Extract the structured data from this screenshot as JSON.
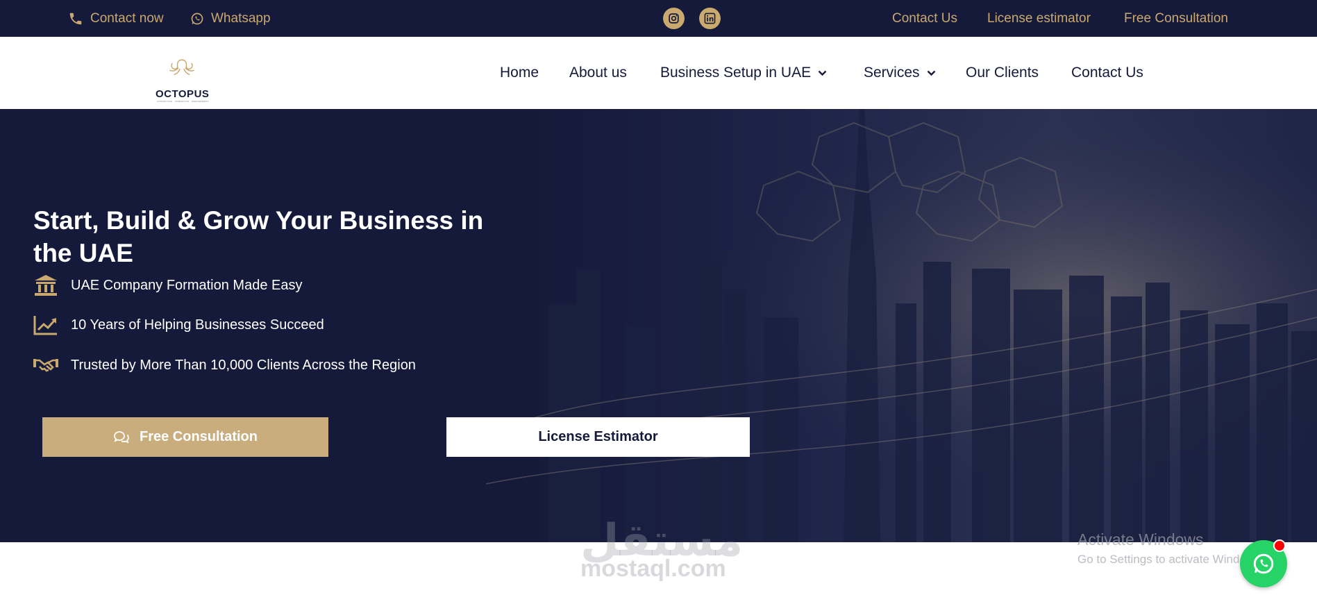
{
  "topbar": {
    "contact_now": "Contact now",
    "whatsapp": "Whatsapp",
    "links": [
      "Contact Us",
      "License estimator",
      "Free Consultation"
    ],
    "social_icons": [
      "instagram-icon",
      "linkedin-icon"
    ]
  },
  "header": {
    "logo_text": "OCTOPUS",
    "logo_sub": "CONSULTING · FORMATION · MANAGEMENT",
    "nav": [
      {
        "label": "Home"
      },
      {
        "label": "About us"
      },
      {
        "label": "Business Setup in UAE"
      },
      {
        "label": "Services"
      },
      {
        "label": "Our Clients"
      },
      {
        "label": "Contact Us"
      }
    ]
  },
  "hero": {
    "title": "Start, Build & Grow Your Business in the UAE",
    "features": [
      {
        "text": "UAE Company Formation Made Easy",
        "icon": "bank-icon"
      },
      {
        "text": "10 Years of Helping Businesses Succeed",
        "icon": "chart-growth-icon"
      },
      {
        "text": "Trusted by More Than 10,000 Clients Across the Region",
        "icon": "handshake-icon"
      }
    ],
    "btn_consult": "Free Consultation",
    "btn_estimator": "License Estimator"
  },
  "overlay": {
    "watermark_ar": "مستقل",
    "watermark_en": "mostaql.com",
    "activate_title": "Activate Windows",
    "activate_sub": "Go to Settings to activate Windows."
  },
  "colors": {
    "navy": "#15193a",
    "gold": "#c9a96e",
    "button_gold": "#c9ad7c",
    "whatsapp_green": "#25d366"
  }
}
